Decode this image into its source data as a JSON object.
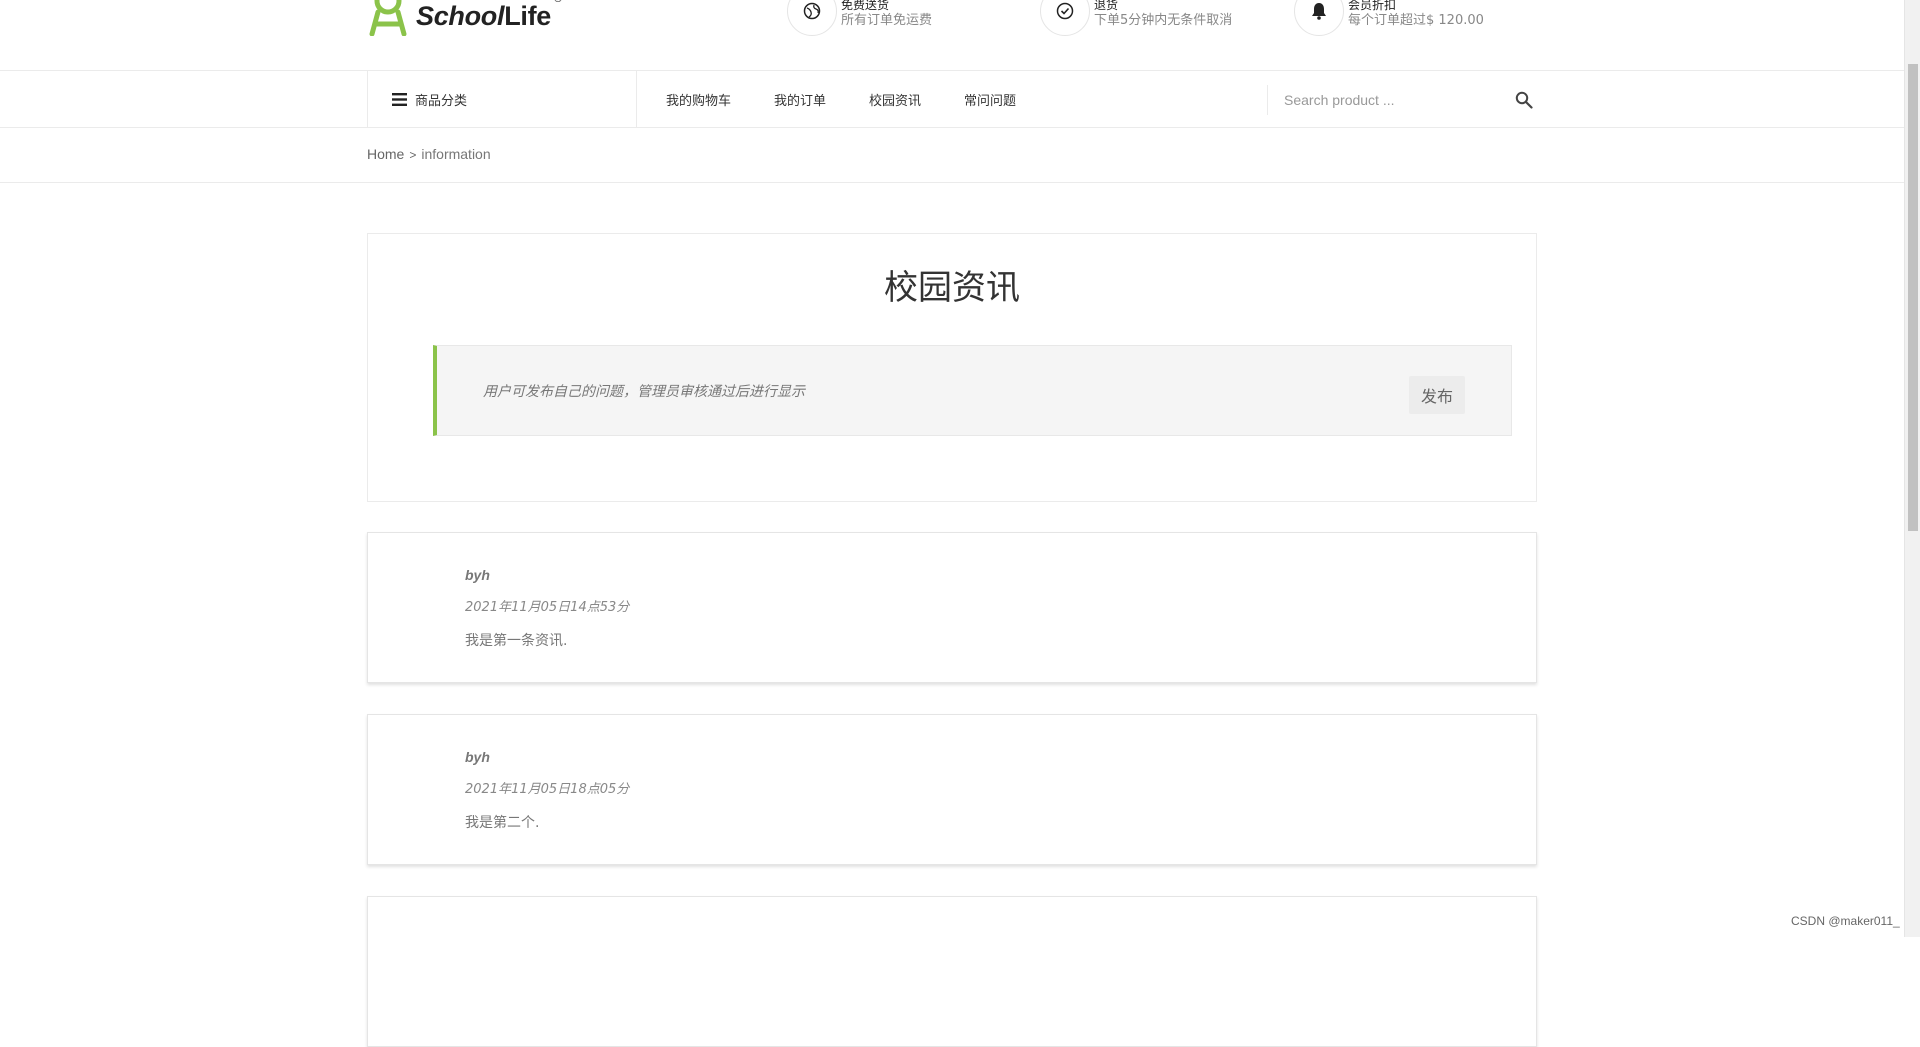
{
  "header": {
    "logo": {
      "school": "School",
      "life": "Life",
      "reg": "®"
    },
    "promos": [
      {
        "icon": "globe-icon",
        "title": "免费送货",
        "desc": "所有订单免运费"
      },
      {
        "icon": "check-circle-icon",
        "title": "退货",
        "desc": "下单5分钟内无条件取消"
      },
      {
        "icon": "bell-icon",
        "title": "会员折扣",
        "desc": "每个订单超过$ 120.00"
      }
    ]
  },
  "nav": {
    "category_label": "商品分类",
    "menu": [
      "我的购物车",
      "我的订单",
      "校园资讯",
      "常问问题"
    ],
    "search_placeholder": "Search product ..."
  },
  "breadcrumb": {
    "home": "Home",
    "separator": ">",
    "current": "information"
  },
  "main": {
    "title": "校园资讯",
    "notice": "用户可发布自己的问题，管理员审核通过后进行显示",
    "publish_label": "发布",
    "accent_color": "#8bc34a"
  },
  "posts": [
    {
      "author": "byh",
      "time": "2021年11月05日14点53分",
      "content": "我是第一条资讯."
    },
    {
      "author": "byh",
      "time": "2021年11月05日18点05分",
      "content": "我是第二个."
    },
    {
      "author": "",
      "time": "",
      "content": ""
    }
  ],
  "watermark": "CSDN @maker011_"
}
